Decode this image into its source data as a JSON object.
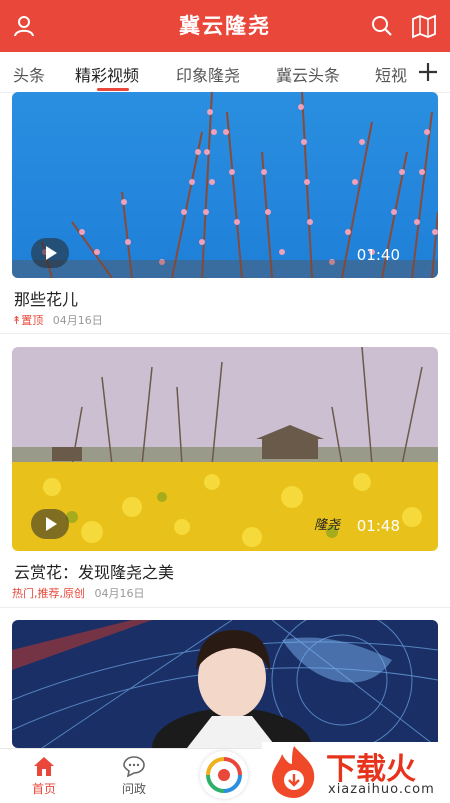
{
  "header": {
    "title": "冀云隆尧"
  },
  "tabs": [
    {
      "label": "头条"
    },
    {
      "label": "精彩视频",
      "active": true
    },
    {
      "label": "印象隆尧"
    },
    {
      "label": "冀云头条"
    },
    {
      "label": "短视"
    }
  ],
  "videos": [
    {
      "title": "那些花儿",
      "duration": "01:40",
      "tag": "置顶",
      "date": "04月16日"
    },
    {
      "title": "云赏花：发现隆尧之美",
      "duration": "01:48",
      "tag": "热门,推荐,原创",
      "date": "04月16日"
    },
    {
      "title": "",
      "duration": "",
      "tag": "",
      "date": ""
    }
  ],
  "video_overlay_text": "隆尧",
  "bottom_nav": [
    {
      "label": "首页",
      "active": true
    },
    {
      "label": "问政"
    }
  ],
  "watermark": {
    "brand": "下载火",
    "url": "xiazaihuo.com"
  },
  "colors": {
    "accent": "#e8473a"
  }
}
